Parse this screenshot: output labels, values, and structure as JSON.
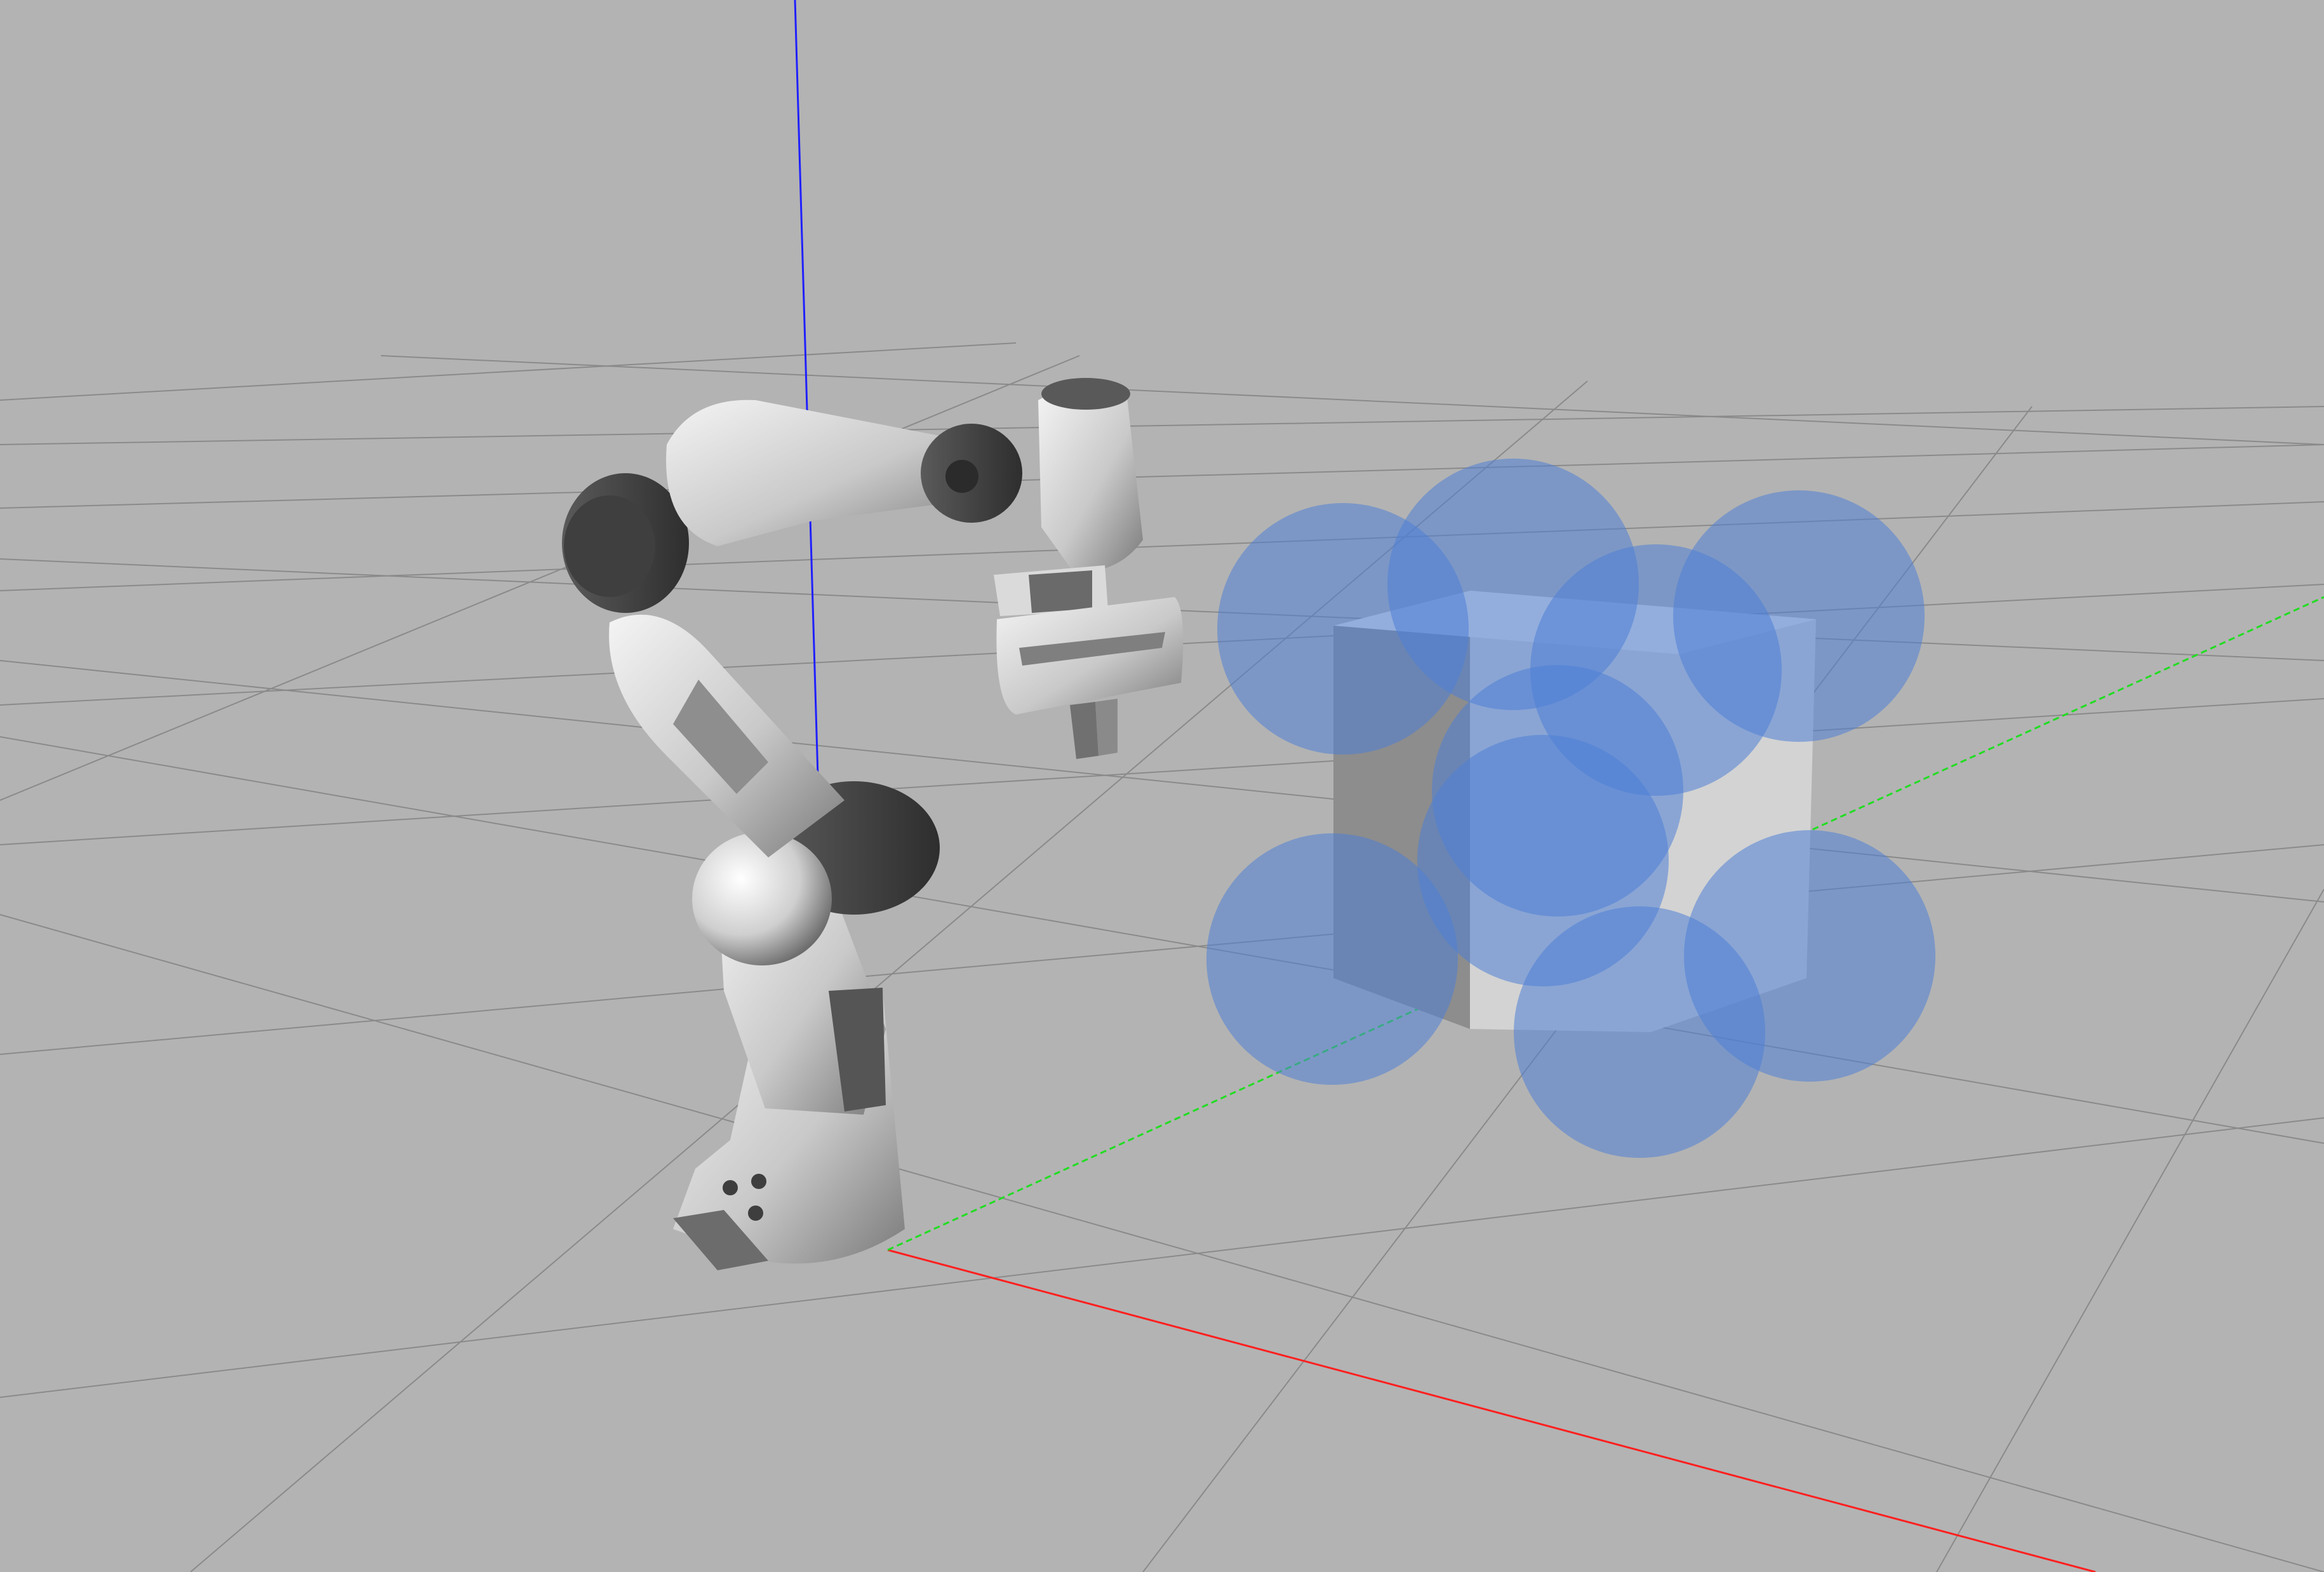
{
  "viewport": {
    "kind": "3d-scene-view",
    "background_color": "#b3b3b3",
    "grid_color": "#8a8a8a",
    "axis_colors": {
      "x": "#ff2020",
      "y": "#22dd22",
      "z": "#2020ff"
    },
    "grid_visible": true
  },
  "scene": {
    "robot": {
      "name": "",
      "link_color": "#e2e2e2",
      "joint_color": "#3c3c3c"
    },
    "obstacle_box": {
      "face_color": "#cbcbcb"
    },
    "collision_spheres": {
      "color": "#4f7fd6",
      "opacity": 0.55,
      "count": 9
    }
  }
}
